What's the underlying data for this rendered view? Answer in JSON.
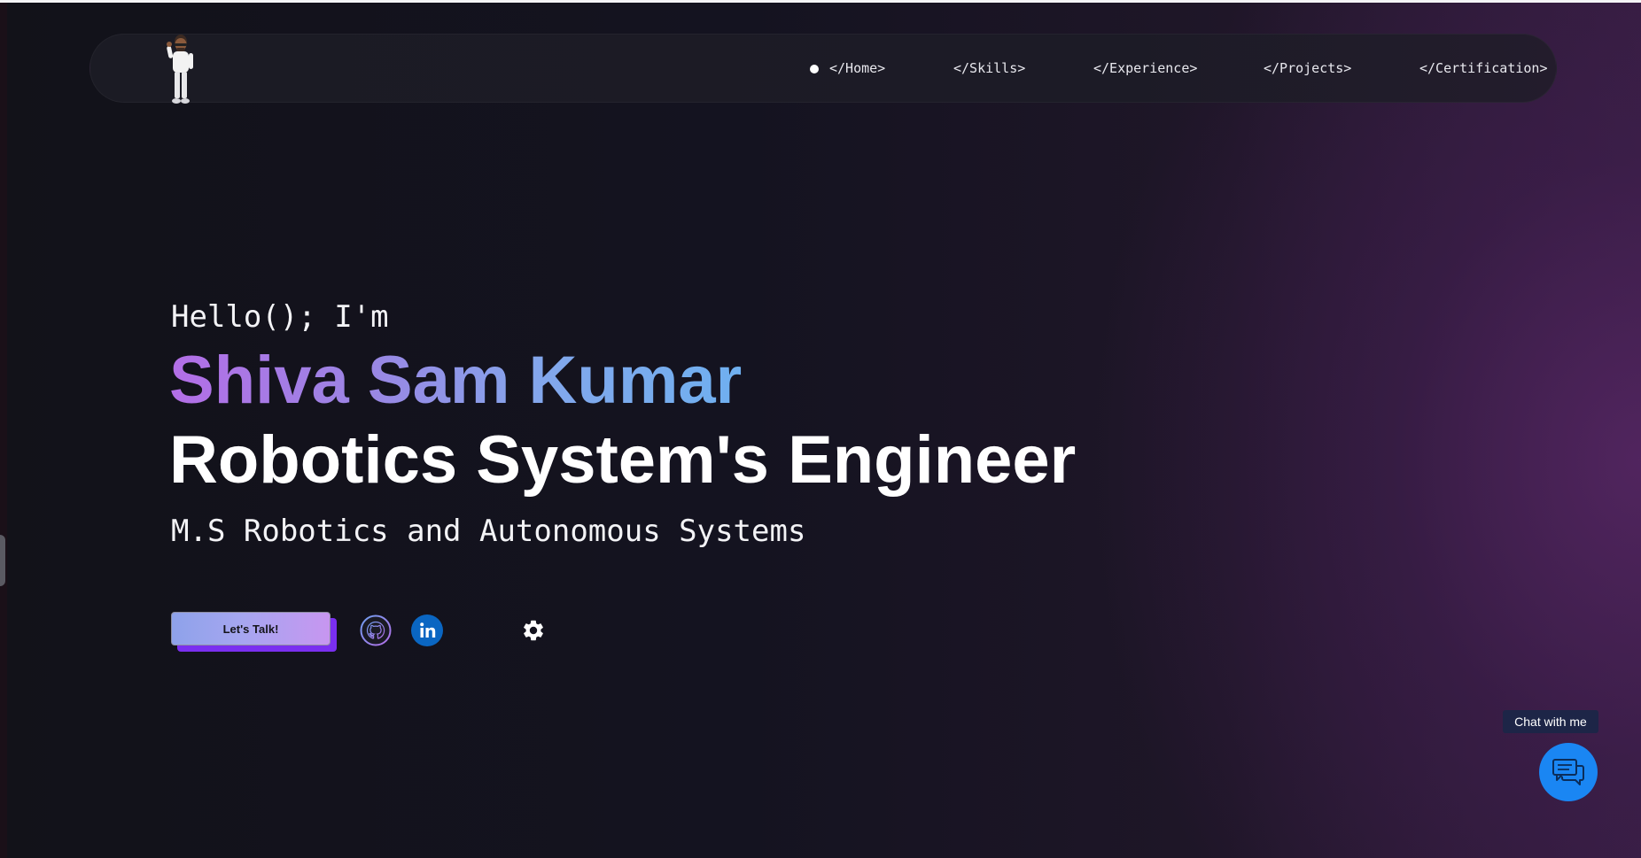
{
  "nav": {
    "items": [
      {
        "label": "</Home>",
        "active": true
      },
      {
        "label": "</Skills>"
      },
      {
        "label": "</Experience>"
      },
      {
        "label": "</Projects>"
      },
      {
        "label": "</Certification>"
      }
    ]
  },
  "hero": {
    "greeting": "Hello(); I'm",
    "name": "Shiva Sam Kumar",
    "role": "Robotics System's Engineer",
    "degree": "M.S Robotics and Autonomous Systems"
  },
  "actions": {
    "cta_label": "Let's Talk!",
    "github_icon": "github-icon",
    "linkedin_icon": "linkedin-icon",
    "settings_icon": "gear-icon"
  },
  "chat": {
    "tooltip": "Chat with me",
    "icon": "chat-bubbles-icon"
  },
  "colors": {
    "background": "#121219",
    "accent_purple": "#b36ee6",
    "accent_blue": "#6fb0f0",
    "chat_blue": "#1a86f3",
    "linkedin_blue": "#0a66c2"
  }
}
